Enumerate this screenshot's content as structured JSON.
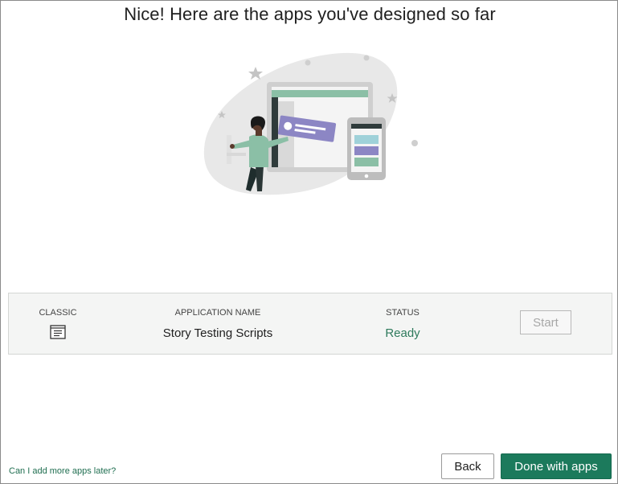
{
  "page": {
    "title": "Nice! Here are the apps you've designed so far"
  },
  "apps_table": {
    "headers": {
      "classic": "CLASSIC",
      "application_name": "APPLICATION NAME",
      "status": "STATUS"
    },
    "rows": [
      {
        "classic_icon": "document-list-icon",
        "application_name": "Story Testing Scripts",
        "status": "Ready",
        "action_label": "Start"
      }
    ]
  },
  "footer": {
    "help_link": "Can I add more apps later?",
    "back_label": "Back",
    "done_label": "Done with apps"
  },
  "colors": {
    "accent": "#1c7a5c",
    "status_ready": "#2e7a5c",
    "link": "#1f6e50"
  }
}
